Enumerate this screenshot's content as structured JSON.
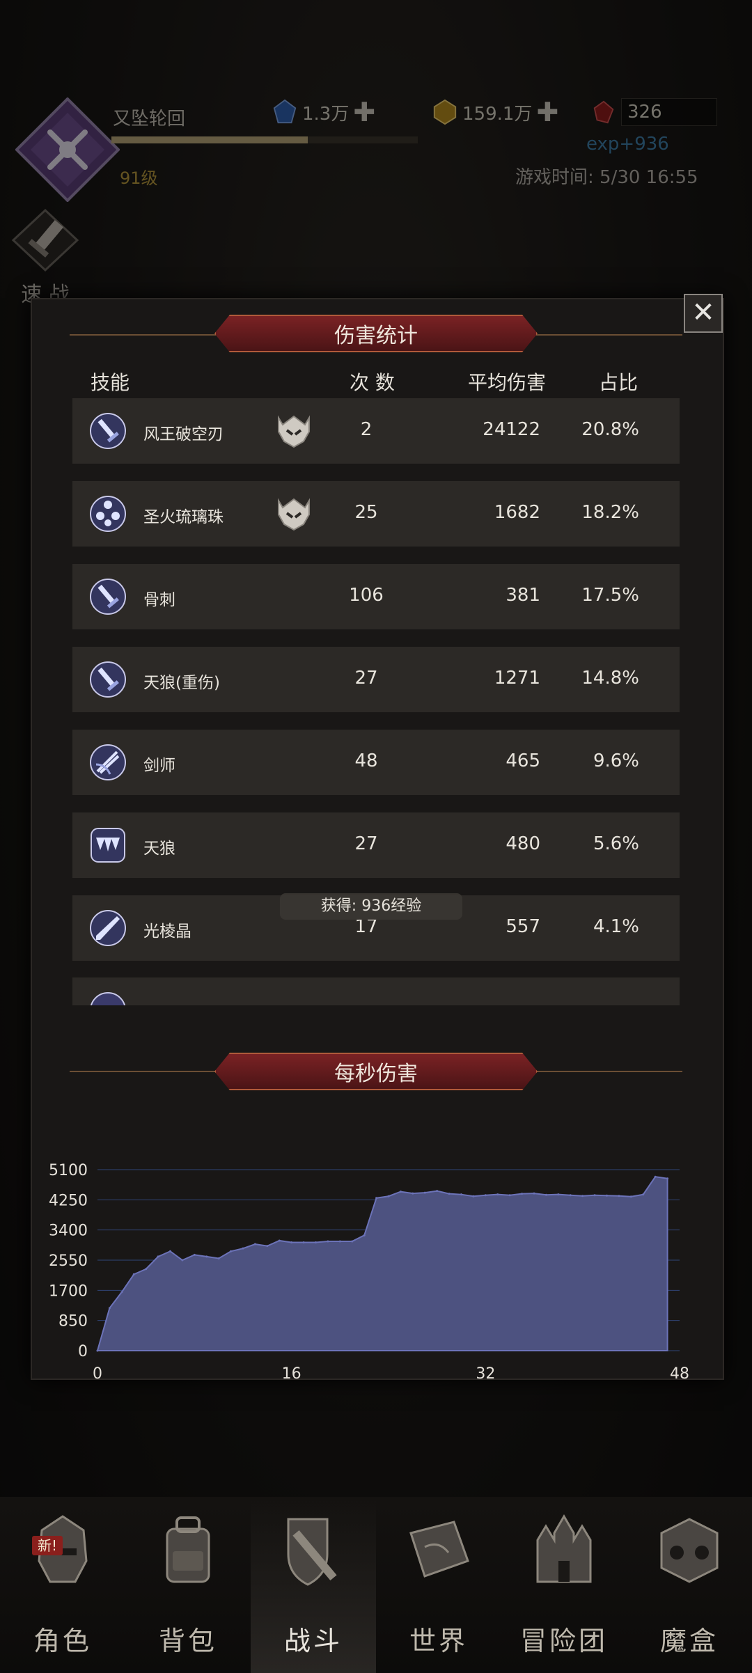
{
  "header": {
    "player_name": "又坠轮回",
    "level": "91级",
    "xp_progress": 0.64,
    "resources": [
      {
        "icon": "blue-crystal-icon",
        "value": "1.3万",
        "plus": true
      },
      {
        "icon": "gold-crystal-icon",
        "value": "159.1万",
        "plus": true
      },
      {
        "icon": "red-crystal-icon",
        "value": "326",
        "plus": false
      }
    ],
    "exp_gain": "exp+936",
    "game_time": "游戏时间: 5/30 16:55",
    "quick_battle": "速 战"
  },
  "modal": {
    "close_label": "✕",
    "damage_title": "伤害统计",
    "columns": {
      "skill": "技能",
      "count": "次 数",
      "avg": "平均伤害",
      "pct": "占比"
    },
    "rows": [
      {
        "name": "风王破空刃",
        "icon": "sword-skill-icon",
        "elite": true,
        "count": "2",
        "avg": "24122",
        "pct": "20.8%"
      },
      {
        "name": "圣火琉璃珠",
        "icon": "orbs-skill-icon",
        "elite": true,
        "count": "25",
        "avg": "1682",
        "pct": "18.2%"
      },
      {
        "name": "骨刺",
        "icon": "sword-skill-icon",
        "elite": false,
        "count": "106",
        "avg": "381",
        "pct": "17.5%"
      },
      {
        "name": "天狼(重伤)",
        "icon": "sword-skill-icon",
        "elite": false,
        "count": "27",
        "avg": "1271",
        "pct": "14.8%"
      },
      {
        "name": "剑师",
        "icon": "sword-slash-skill-icon",
        "elite": false,
        "count": "48",
        "avg": "465",
        "pct": "9.6%"
      },
      {
        "name": "天狼",
        "icon": "fangs-skill-icon",
        "elite": false,
        "count": "27",
        "avg": "480",
        "pct": "5.6%"
      },
      {
        "name": "光棱晶",
        "icon": "crystal-blade-skill-icon",
        "elite": false,
        "count": "17",
        "avg": "557",
        "pct": "4.1%"
      }
    ],
    "xp_toast": "获得: 936经验",
    "dps_title": "每秒伤害"
  },
  "chart_data": {
    "type": "area",
    "title": "每秒伤害",
    "x": [
      0,
      1,
      2,
      3,
      4,
      5,
      6,
      7,
      8,
      9,
      10,
      11,
      12,
      13,
      14,
      15,
      16,
      17,
      18,
      19,
      20,
      21,
      22,
      23,
      24,
      25,
      26,
      27,
      28,
      29,
      30,
      31,
      32,
      33,
      34,
      35,
      36,
      37,
      38,
      39,
      40,
      41,
      42,
      43,
      44,
      45,
      46,
      47
    ],
    "y": [
      0,
      1200,
      1650,
      2150,
      2300,
      2650,
      2800,
      2550,
      2700,
      2650,
      2600,
      2800,
      2880,
      3000,
      2950,
      3100,
      3050,
      3050,
      3050,
      3080,
      3080,
      3080,
      3250,
      4300,
      4350,
      4480,
      4430,
      4450,
      4500,
      4420,
      4400,
      4350,
      4380,
      4400,
      4380,
      4420,
      4430,
      4390,
      4400,
      4380,
      4360,
      4380,
      4370,
      4360,
      4340,
      4400,
      4900,
      4850
    ],
    "yticks": [
      0,
      850,
      1700,
      2550,
      3400,
      4250,
      5100
    ],
    "xticks": [
      0,
      16,
      32,
      48
    ],
    "xlim": [
      0,
      48
    ],
    "ylim": [
      0,
      5100
    ],
    "grid": true,
    "colors": {
      "fill": "#4d5280",
      "stroke": "#6c73b8",
      "grid": "#3a58a0"
    }
  },
  "nav": {
    "items": [
      {
        "label": "角色",
        "icon": "helmet-icon",
        "badge": "新!"
      },
      {
        "label": "背包",
        "icon": "backpack-icon"
      },
      {
        "label": "战斗",
        "icon": "shield-sword-icon",
        "active": true
      },
      {
        "label": "世界",
        "icon": "map-scroll-icon"
      },
      {
        "label": "冒险团",
        "icon": "castle-icon"
      },
      {
        "label": "魔盒",
        "icon": "magic-cube-icon"
      }
    ]
  }
}
